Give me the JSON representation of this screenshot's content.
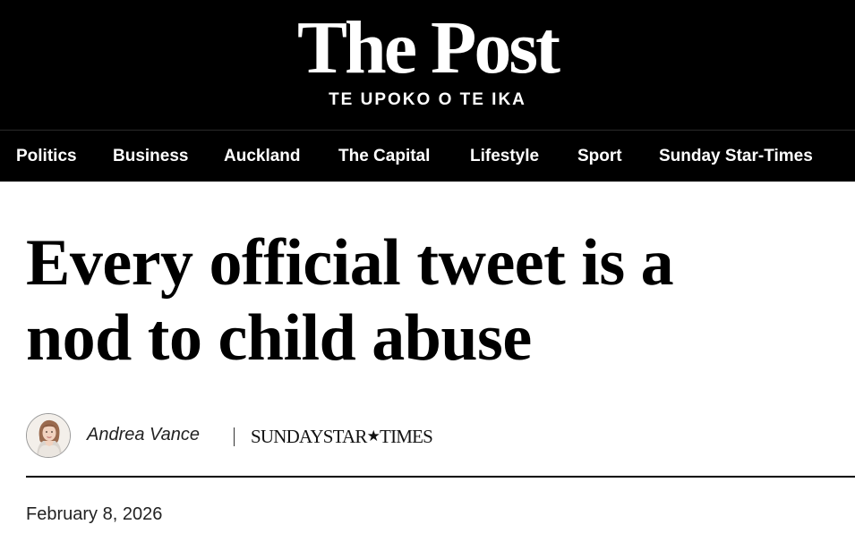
{
  "masthead": {
    "logo": "The Post",
    "tagline": "TE UPOKO O TE IKA"
  },
  "nav": {
    "items": [
      {
        "label": "Politics"
      },
      {
        "label": "Business"
      },
      {
        "label": "Auckland"
      },
      {
        "label": "The Capital"
      },
      {
        "label": "Lifestyle"
      },
      {
        "label": "Sport"
      },
      {
        "label": "Sunday Star-Times"
      }
    ]
  },
  "article": {
    "headline_line1": "Every official tweet is a",
    "headline_line2": "nod to child abuse",
    "author": "Andrea Vance",
    "publication": {
      "part1": "SUNDAY",
      "part2": "STAR",
      "star": "★",
      "part3": "TIMES"
    },
    "date": "February 8, 2026"
  },
  "colors": {
    "masthead_bg": "#000000",
    "nav_text": "#ffffff",
    "body_bg": "#ffffff"
  }
}
